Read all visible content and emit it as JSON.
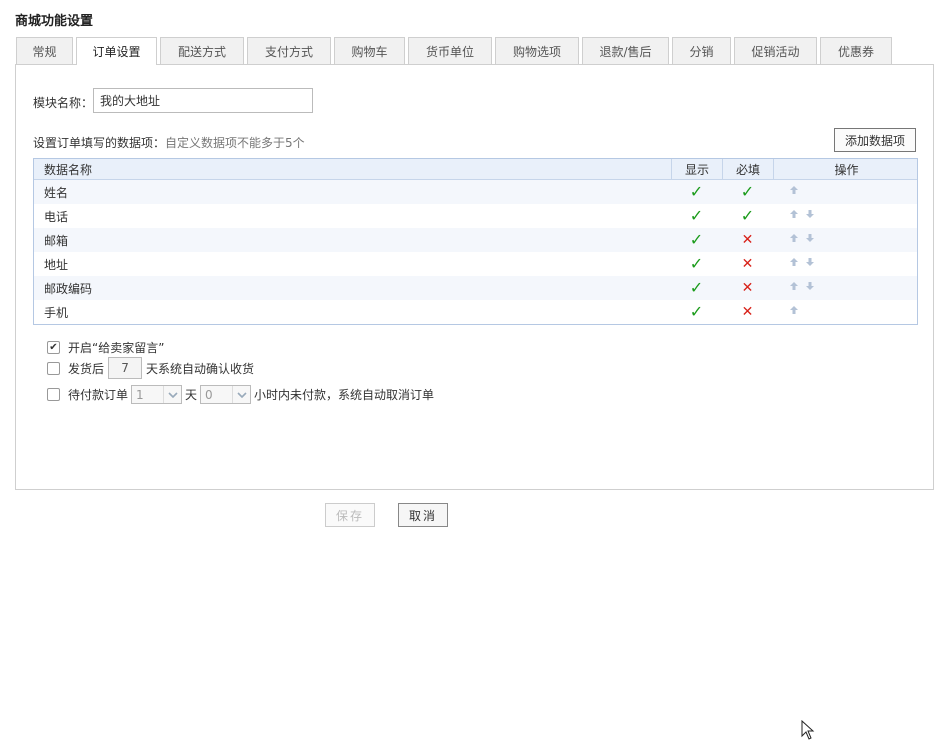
{
  "page": {
    "title": "商城功能设置"
  },
  "tabs": [
    {
      "label": "常规",
      "active": false
    },
    {
      "label": "订单设置",
      "active": true
    },
    {
      "label": "配送方式",
      "active": false
    },
    {
      "label": "支付方式",
      "active": false
    },
    {
      "label": "购物车",
      "active": false
    },
    {
      "label": "货币单位",
      "active": false
    },
    {
      "label": "购物选项",
      "active": false
    },
    {
      "label": "退款/售后",
      "active": false
    },
    {
      "label": "分销",
      "active": false
    },
    {
      "label": "促销活动",
      "active": false
    },
    {
      "label": "优惠券",
      "active": false
    }
  ],
  "module": {
    "label": "模块名称：",
    "value": "我的大地址"
  },
  "fields": {
    "label": "设置订单填写的数据项：",
    "hint": "自定义数据项不能多于5个",
    "add_button": "添加数据项"
  },
  "table": {
    "headers": {
      "name": "数据名称",
      "show": "显示",
      "required": "必填",
      "ops": "操作"
    },
    "rows": [
      {
        "name": "姓名",
        "show": true,
        "required": true,
        "up": true,
        "down": false
      },
      {
        "name": "电话",
        "show": true,
        "required": true,
        "up": true,
        "down": true
      },
      {
        "name": "邮箱",
        "show": true,
        "required": false,
        "up": true,
        "down": true
      },
      {
        "name": "地址",
        "show": true,
        "required": false,
        "up": true,
        "down": true
      },
      {
        "name": "邮政编码",
        "show": true,
        "required": false,
        "up": true,
        "down": true
      },
      {
        "name": "手机",
        "show": true,
        "required": false,
        "up": true,
        "down": false
      }
    ]
  },
  "options": {
    "seller_msg": {
      "checked": true,
      "label": "开启“给卖家留言”"
    },
    "auto_confirm": {
      "checked": false,
      "prefix": "发货后",
      "days": "7",
      "suffix": "天系统自动确认收货"
    },
    "auto_cancel": {
      "checked": false,
      "prefix": "待付款订单",
      "day_value": "1",
      "day_unit": "天",
      "hour_value": "0",
      "suffix": "小时内未付款，系统自动取消订单"
    }
  },
  "actions": {
    "save": "保存",
    "cancel": "取消"
  },
  "colors": {
    "check": "#1a9b1a",
    "cross": "#d8221a",
    "table_header": "#e9f0fa",
    "table_border": "#b5c8e3"
  }
}
